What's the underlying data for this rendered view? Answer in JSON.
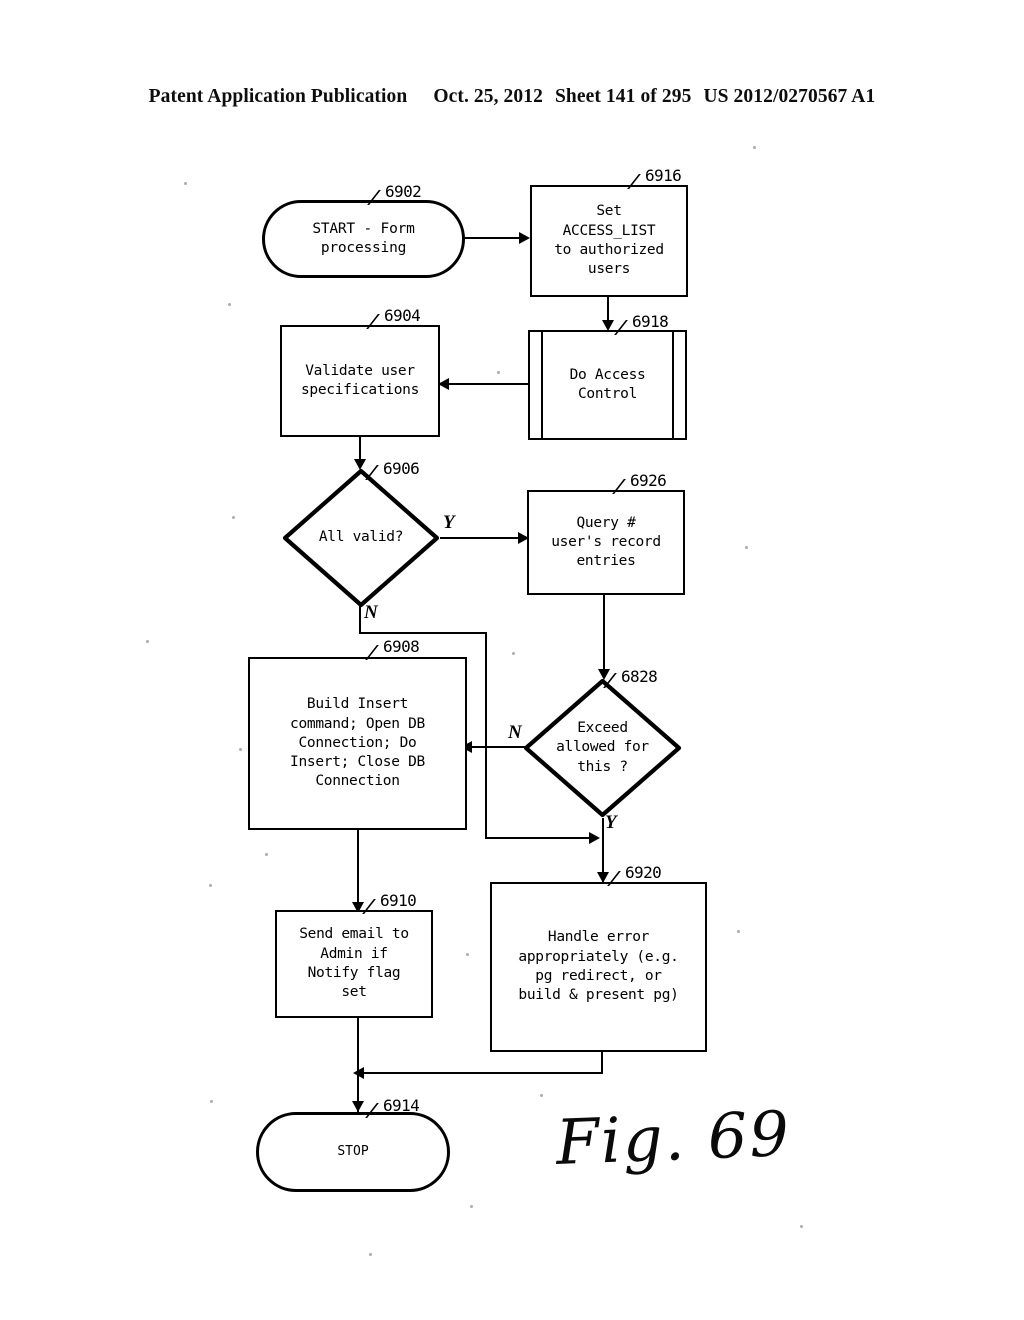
{
  "header": {
    "publication": "Patent Application Publication",
    "date": "Oct. 25, 2012",
    "sheet": "Sheet 141 of 295",
    "docnum": "US 2012/0270567 A1"
  },
  "figure": {
    "caption": "Fig. 69"
  },
  "nodes": {
    "start": {
      "ref": "6902",
      "text": "START - Form\nprocessing",
      "shape": "terminator"
    },
    "set_access_list": {
      "ref": "6916",
      "text": "Set\nACCESS_LIST\nto authorized\nusers",
      "shape": "process"
    },
    "do_access_control": {
      "ref": "6918",
      "text": "Do Access\nControl",
      "shape": "predefined-process"
    },
    "validate_user": {
      "ref": "6904",
      "text": "Validate user\nspecifications",
      "shape": "process"
    },
    "all_valid": {
      "ref": "6906",
      "text": "All valid?",
      "shape": "decision"
    },
    "query_records": {
      "ref": "6926",
      "text": "Query #\nuser's record\nentries",
      "shape": "process"
    },
    "exceed_allowed": {
      "ref": "6828",
      "text": "Exceed\nallowed for\nthis ?",
      "shape": "decision"
    },
    "build_insert": {
      "ref": "6908",
      "text": "Build Insert\ncommand; Open DB\nConnection; Do\nInsert; Close DB\nConnection",
      "shape": "process"
    },
    "send_email": {
      "ref": "6910",
      "text": "Send email to\nAdmin if\nNotify flag\nset",
      "shape": "process"
    },
    "handle_error": {
      "ref": "6920",
      "text": "Handle error\nappropriately (e.g.\npg redirect, or\nbuild & present pg)",
      "shape": "process"
    },
    "stop": {
      "ref": "6914",
      "text": "STOP",
      "shape": "terminator"
    }
  },
  "branches": {
    "all_valid_yes": "Y",
    "all_valid_no": "N",
    "exceed_no": "N",
    "exceed_yes": "Y"
  },
  "colors": {
    "ink": "#000000",
    "paper": "#ffffff"
  }
}
